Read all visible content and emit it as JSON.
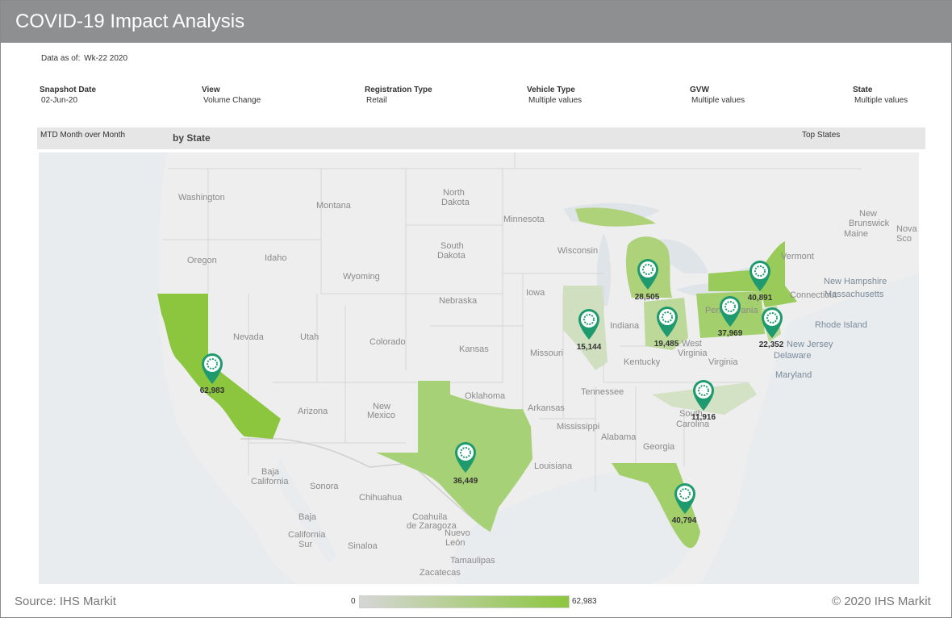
{
  "app": {
    "title": "COVID-19 Impact Analysis"
  },
  "as_of": {
    "label": "Data as of:",
    "value": "Wk-22 2020"
  },
  "filters": [
    {
      "label": "Snapshot Date",
      "value": "02-Jun-20"
    },
    {
      "label": "View",
      "value": "Volume Change"
    },
    {
      "label": "Registration Type",
      "value": "Retail"
    },
    {
      "label": "Vehicle Type",
      "value": "Multiple values"
    },
    {
      "label": "GVW",
      "value": "Multiple values"
    },
    {
      "label": "State",
      "value": "Multiple values"
    }
  ],
  "header": {
    "left": "MTD Month over Month",
    "middle": "by State",
    "right": "Top States"
  },
  "map_labels": {
    "washington": "Washington",
    "montana": "Montana",
    "north": "North",
    "dakota": "Dakota",
    "minnesota": "Minnesota",
    "oregon": "Oregon",
    "idaho": "Idaho",
    "south": "South",
    "dakota2": "Dakota",
    "wisconsin": "Wisconsin",
    "wyoming": "Wyoming",
    "iowa": "Iowa",
    "nebraska": "Nebraska",
    "nevada": "Nevada",
    "utah": "Utah",
    "colorado": "Colorado",
    "kansas": "Kansas",
    "missouri": "Missouri",
    "indiana": "Indiana",
    "west": "West",
    "virginia": "Virginia",
    "virginia2": "Virginia",
    "kentucky": "Kentucky",
    "oklahoma": "Oklahoma",
    "tennessee": "Tennessee",
    "arizona": "Arizona",
    "new": "New",
    "mexico": "Mexico",
    "arkansas": "Arkansas",
    "south2": "South",
    "carolina": "Carolina",
    "mississippi": "Mississippi",
    "alabama": "Alabama",
    "georgia": "Georgia",
    "louisiana": "Louisiana",
    "baja": "Baja",
    "california": "California",
    "sonora": "Sonora",
    "chihuahua": "Chihuahua",
    "coahuila": "Coahuila",
    "de_zaragoza": "de Zaragoza",
    "nuevo": "Nuevo",
    "leon": "León",
    "tamaulipas": "Tamaulipas",
    "baja2": "Baja",
    "california2": "California",
    "sur": "Sur",
    "sinaloa": "Sinaloa",
    "zacatecas": "Zacatecas",
    "new2": "New",
    "brunswick": "Brunswick",
    "maine": "Maine",
    "nova": "Nova",
    "sco": "Sco",
    "vermont": "Vermont",
    "new_hampshire": "New Hampshire",
    "massachusetts": "Massachusetts",
    "connecticut": "Connecticut",
    "rhode_island": "Rhode Island",
    "new_jersey": "New Jersey",
    "delaware": "Delaware",
    "maryland": "Maryland",
    "pennsylvania": "Pennsylvania"
  },
  "pins": [
    {
      "state": "California",
      "value": "62,983"
    },
    {
      "state": "Texas",
      "value": "36,449"
    },
    {
      "state": "Illinois",
      "value": "15,144"
    },
    {
      "state": "Michigan",
      "value": "28,505"
    },
    {
      "state": "Ohio",
      "value": "19,485"
    },
    {
      "state": "Pennsylvania",
      "value": "37,969"
    },
    {
      "state": "New York",
      "value": "40,891"
    },
    {
      "state": "New Jersey",
      "value": "22,352"
    },
    {
      "state": "North Carolina",
      "value": "11,916"
    },
    {
      "state": "Florida",
      "value": "40,794"
    }
  ],
  "legend": {
    "min": "0",
    "max": "62,983"
  },
  "footer": {
    "source": "Source: IHS Markit",
    "copyright": "© 2020 IHS Markit"
  },
  "colors": {
    "title_bar": "#8e8f91",
    "pin": "#1f9a6e",
    "fill_high": "#8cc63f",
    "fill_low": "#d6d6d6",
    "water": "#e8ecef"
  }
}
